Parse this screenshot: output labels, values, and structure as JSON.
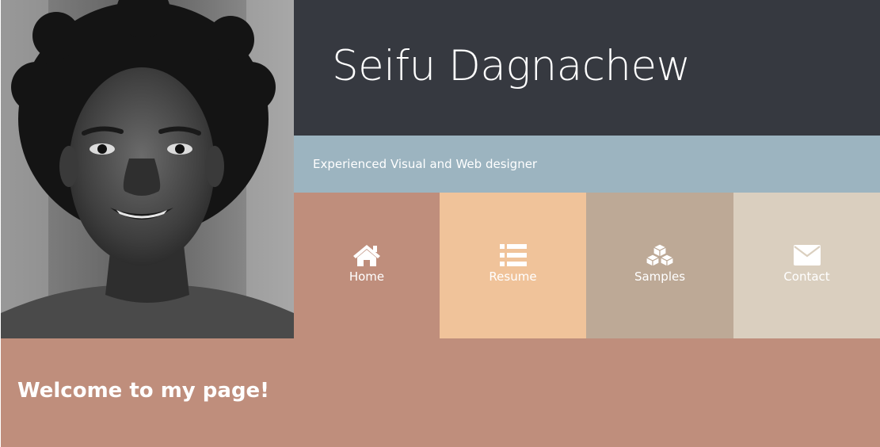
{
  "profile": {
    "name": "Seifu Dagnachew",
    "tagline": "Experienced Visual and Web designer"
  },
  "nav": {
    "items": [
      {
        "label": "Home",
        "icon": "home-icon",
        "color": "#bf8e7c"
      },
      {
        "label": "Resume",
        "icon": "list-icon",
        "color": "#f0c39a"
      },
      {
        "label": "Samples",
        "icon": "cubes-icon",
        "color": "#bda996"
      },
      {
        "label": "Contact",
        "icon": "envelope-icon",
        "color": "#dacfbf"
      }
    ]
  },
  "welcome": {
    "heading": "Welcome to my page!"
  },
  "colors": {
    "header_bg": "#363940",
    "tagline_bg": "#9cb4c0",
    "welcome_bg": "#bf8e7c"
  }
}
